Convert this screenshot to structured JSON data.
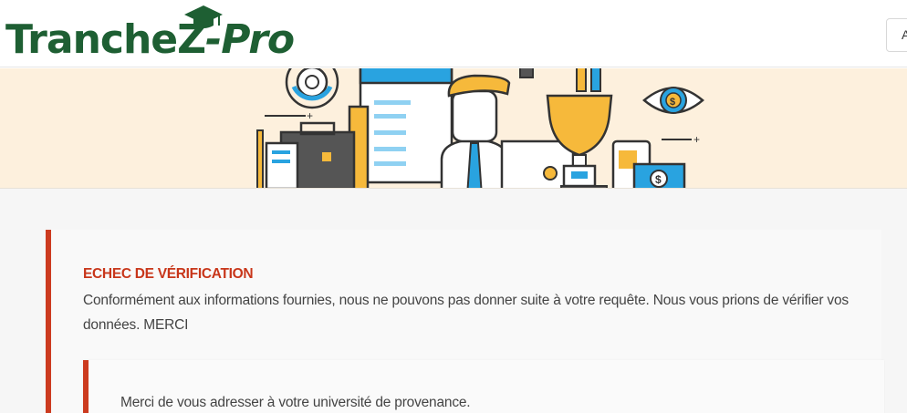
{
  "header": {
    "logo_text_main": "TrancheZ",
    "logo_text_suffix": "-Pro",
    "button_label": "A",
    "brand_color": "#1e5f33"
  },
  "banner": {
    "background_color": "#fdf0dd",
    "illustration": "office-career-illustration"
  },
  "alert": {
    "title": "ECHEC DE VÉRIFICATION",
    "message": "Conformément aux informations fournies, nous ne pouvons pas donner suite à votre requête. Nous vous prions de vérifier vos données. MERCI",
    "quote": "Merci de vous adresser à votre université de provenance.",
    "accent_color": "#cc3b1f"
  }
}
